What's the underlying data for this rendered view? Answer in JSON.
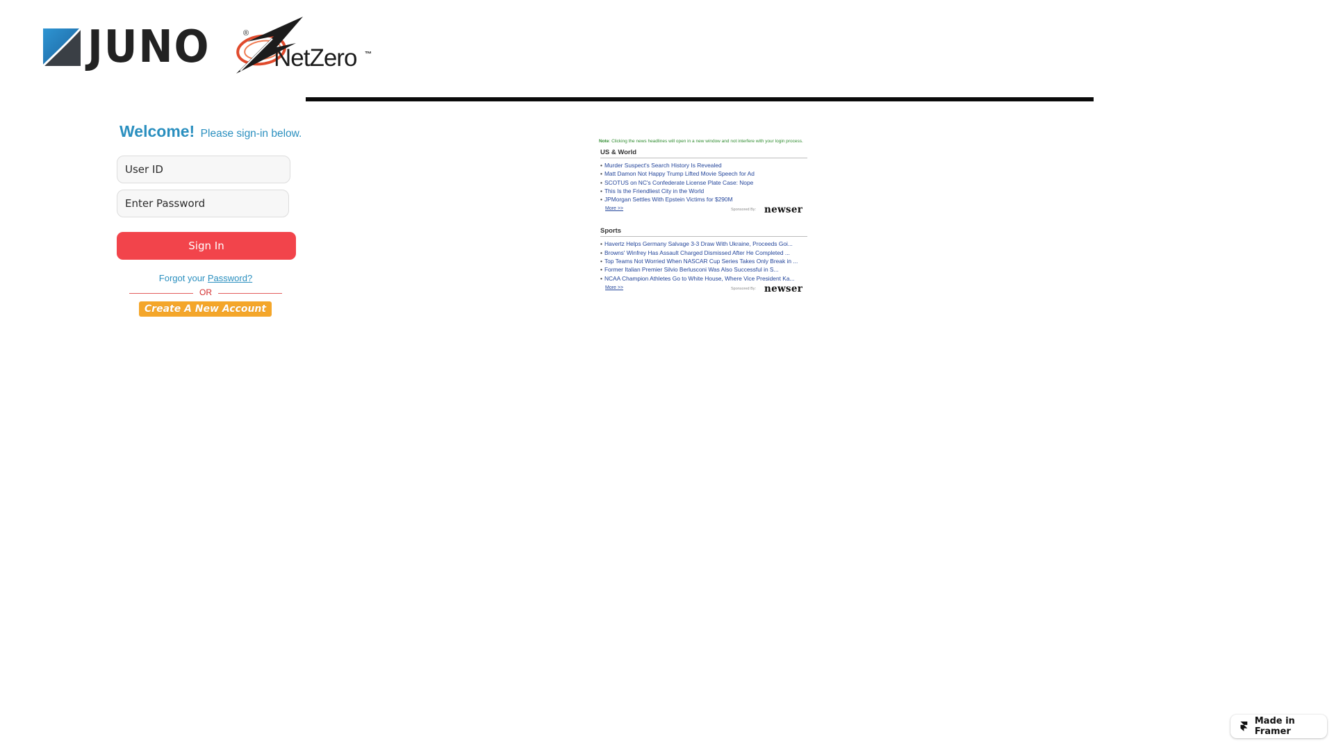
{
  "header": {
    "juno_logo_text": "JUNO",
    "juno_reg_mark": "®",
    "netzero_logo_text": "NetZero",
    "netzero_tm_mark": "™"
  },
  "signin": {
    "welcome_title": "Welcome!",
    "welcome_subtitle": "Please sign-in below.",
    "user_id_placeholder": "User ID",
    "password_placeholder": "Enter Password",
    "sign_in_label": "Sign In",
    "forgot_prefix": "Forgot your",
    "forgot_link": "Password?",
    "or_label": "OR",
    "create_account_label": "Create A New Account"
  },
  "news": {
    "note_label": "Note",
    "note_text": ": Clicking the news headlines will open in a new window and not interfere with your login process.",
    "sections": [
      {
        "heading": "US & World",
        "items": [
          "Murder Suspect's Search History Is Revealed",
          "Matt Damon Not Happy Trump Lifted Movie Speech for Ad",
          "SCOTUS on NC's Confederate License Plate Case: Nope",
          "This Is the Friendliest City in the World",
          "JPMorgan Settles With Epstein Victims for $290M"
        ],
        "more_label": "More >>",
        "sponsored_label": "Sponsored By:",
        "sponsor_name": "newser"
      },
      {
        "heading": "Sports",
        "items": [
          "Havertz Helps Germany Salvage 3-3 Draw With Ukraine, Proceeds Goi...",
          "Browns' Winfrey Has Assault Charged Dismissed After He Completed ...",
          "Top Teams Not Worried When NASCAR Cup Series Takes Only Break in ...",
          "Former Italian Premier Silvio Berlusconi Was Also Successful in S...",
          "NCAA Champion Athletes Go to White House, Where Vice President Ka..."
        ],
        "more_label": "More >>",
        "sponsored_label": "Sponsored By:",
        "sponsor_name": "newser"
      }
    ]
  },
  "framer_badge": {
    "label": "Made in Framer",
    "icon": "framer-icon"
  },
  "colors": {
    "brand_blue": "#2a8fbf",
    "sign_in_red": "#f2444b",
    "create_account_orange": "#f4a62a",
    "link_blue": "#22449a",
    "note_green": "#2e8b2e"
  }
}
